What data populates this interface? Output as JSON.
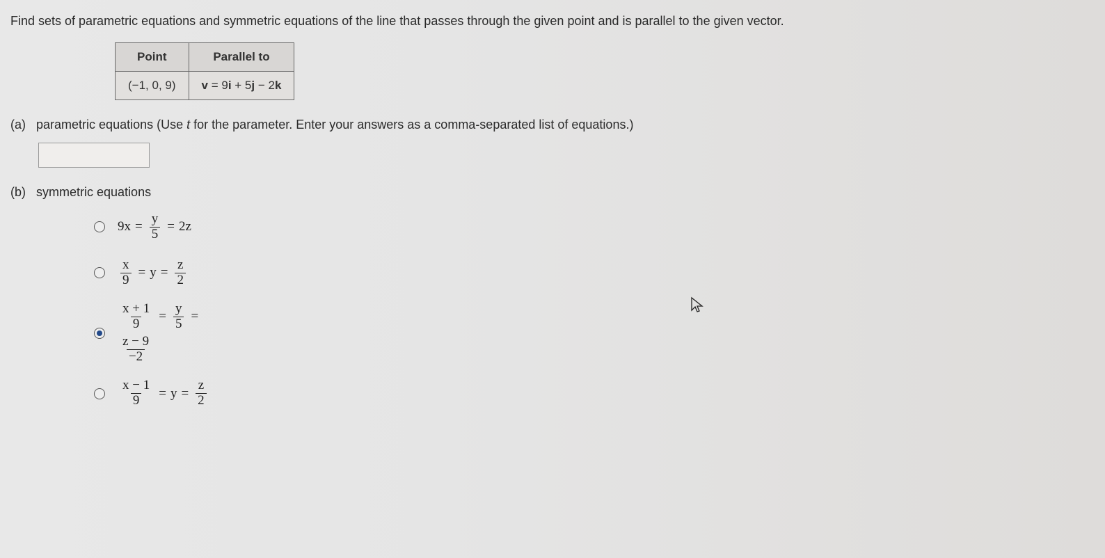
{
  "prompt": "Find sets of parametric equations and symmetric equations of the line that passes through the given point and is parallel to the given vector.",
  "table": {
    "header1": "Point",
    "header2": "Parallel to",
    "point": "(−1, 0, 9)",
    "vector_prefix": "v",
    "vector_middle": " = 9",
    "vector_i": "i",
    "vector_plus": " + 5",
    "vector_j": "j",
    "vector_minus": " − 2",
    "vector_k": "k"
  },
  "part_a": {
    "label": "(a)",
    "text": "parametric equations (Use ",
    "param": "t",
    "text2": " for the parameter. Enter your answers as a comma-separated list of equations.)"
  },
  "part_b": {
    "label": "(b)",
    "text": "symmetric equations"
  },
  "options": {
    "opt1": {
      "lhs": "9x",
      "eq1": "=",
      "num1": "y",
      "den1": "5",
      "eq2": "=",
      "rhs": "2z"
    },
    "opt2": {
      "num1": "x",
      "den1": "9",
      "eq1": "=",
      "mid": "y",
      "eq2": "=",
      "num2": "z",
      "den2": "2"
    },
    "opt3": {
      "num1": "x + 1",
      "den1": "9",
      "eq1": "=",
      "num2": "y",
      "den2": "5",
      "eq2": "=",
      "num3": "z − 9",
      "den3": "−2"
    },
    "opt4": {
      "num1": "x − 1",
      "den1": "9",
      "eq1": "=",
      "mid": "y",
      "eq2": "=",
      "num2": "z",
      "den2": "2"
    }
  },
  "selected_option": 3
}
